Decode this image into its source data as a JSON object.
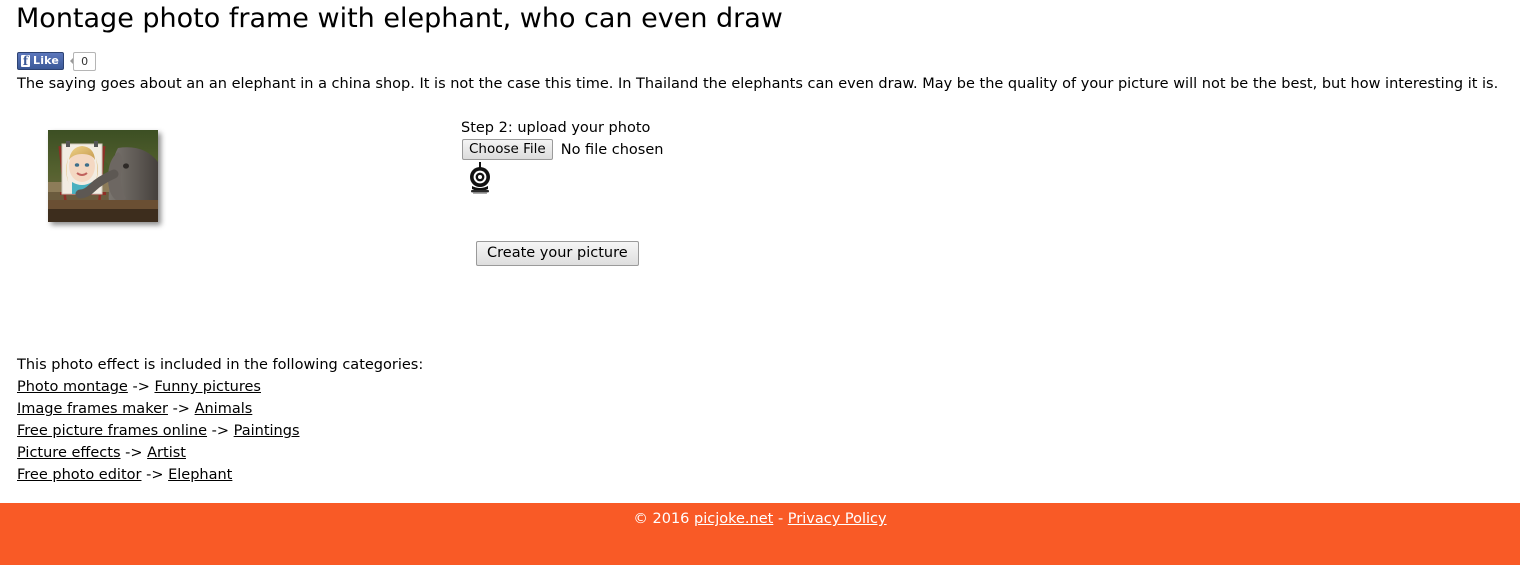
{
  "page": {
    "title": "Montage photo frame with elephant, who can even draw",
    "description": "The saying goes about an an elephant in a china shop. It is not the case this time. In Thailand the elephants can even draw. May be the quality of your picture will not be the best, but how interesting it is."
  },
  "social": {
    "facebook_icon": "facebook-f-icon",
    "like_label": "Like",
    "like_count": "0"
  },
  "sample": {
    "alt": "elephant painting a portrait of a woman on an easel",
    "icon": "sample-preview-image"
  },
  "upload": {
    "step_label": "Step 2: upload your photo",
    "choose_file_label": "Choose File",
    "file_status": "No file chosen",
    "webcam_icon": "webcam-icon",
    "create_label": "Create your picture"
  },
  "categories": {
    "intro": "This photo effect is included in the following categories:",
    "separator": "->",
    "rows": [
      {
        "parent": "Photo montage",
        "child": "Funny pictures"
      },
      {
        "parent": "Image frames maker",
        "child": "Animals"
      },
      {
        "parent": "Free picture frames online",
        "child": "Paintings"
      },
      {
        "parent": "Picture effects",
        "child": "Artist"
      },
      {
        "parent": "Free photo editor",
        "child": "Elephant"
      }
    ]
  },
  "footer": {
    "copyright": "© 2016",
    "site_link": "picjoke.net",
    "separator": "-",
    "privacy_link": "Privacy Policy",
    "background_color": "#f95a26"
  }
}
